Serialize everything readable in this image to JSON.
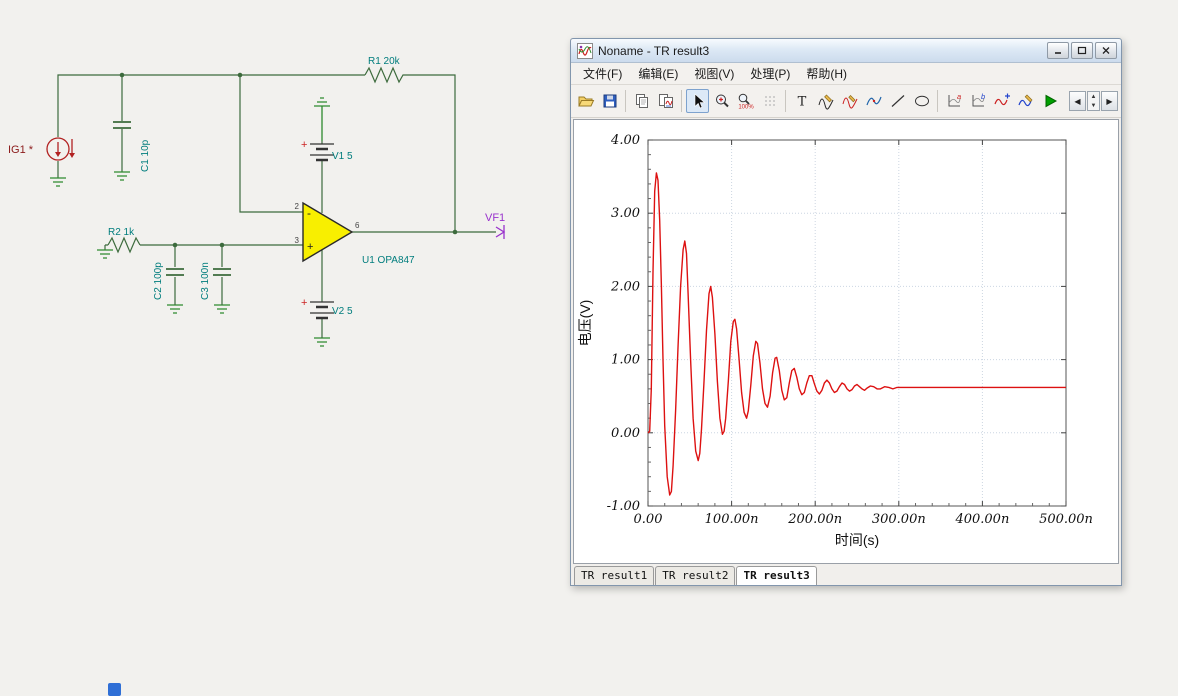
{
  "desktop": {
    "background": "#f2f1ee"
  },
  "schematic": {
    "labels": {
      "ig1": "IG1 *",
      "c1": "C1 10p",
      "r1": "R1 20k",
      "r2": "R2 1k",
      "c2": "C2 100p",
      "c3": "C3 100n",
      "v1": "V1 5",
      "v2": "V2 5",
      "u1": "U1 OPA847",
      "vf1": "VF1",
      "pin_inverting": "2",
      "pin_noninverting": "3",
      "pin_output": "6",
      "minus_sign": "-",
      "plus_sign": "+",
      "v1_plus": "+",
      "v2_plus": "+"
    },
    "colors": {
      "wire": "#3d6b3d",
      "label": "#007d7d",
      "source": "#b22222",
      "opamp_fill": "#f8ef00",
      "output_label": "#9932cc"
    }
  },
  "window": {
    "title": "Noname - TR result3",
    "menu": [
      "文件(F)",
      "编辑(E)",
      "视图(V)",
      "处理(P)",
      "帮助(H)"
    ],
    "toolbar": {
      "text_tool_glyph": "T",
      "zoom_level": "100%",
      "axis_a": "a",
      "axis_b": "b"
    },
    "tabs": [
      {
        "label": "TR result1",
        "active": false
      },
      {
        "label": "TR result2",
        "active": false
      },
      {
        "label": "TR result3",
        "active": true
      }
    ]
  },
  "chart_data": {
    "type": "line",
    "title": "",
    "xlabel": "时间(s)",
    "ylabel": "电压(V)",
    "x_unit": "ns",
    "xlim": [
      0,
      500
    ],
    "ylim": [
      -1,
      4
    ],
    "x_ticks": [
      0,
      100,
      200,
      300,
      400,
      500
    ],
    "x_tick_labels": [
      "0.00",
      "100.00n",
      "200.00n",
      "300.00n",
      "400.00n",
      "500.00n"
    ],
    "y_ticks": [
      -1,
      0,
      1,
      2,
      3,
      4
    ],
    "y_tick_labels": [
      "-1.00",
      "0.00",
      "1.00",
      "2.00",
      "3.00",
      "4.00"
    ],
    "grid": true,
    "legend": "none",
    "series": [
      {
        "name": "VF1",
        "color": "#dd1111",
        "points": [
          [
            0,
            0
          ],
          [
            2,
            0.02
          ],
          [
            4,
            0.6
          ],
          [
            6,
            2.2
          ],
          [
            8,
            3.3
          ],
          [
            10,
            3.55
          ],
          [
            12,
            3.45
          ],
          [
            14,
            2.9
          ],
          [
            16,
            2.0
          ],
          [
            18,
            1.0
          ],
          [
            20,
            0.1
          ],
          [
            23,
            -0.6
          ],
          [
            26,
            -0.85
          ],
          [
            28,
            -0.8
          ],
          [
            30,
            -0.45
          ],
          [
            33,
            0.3
          ],
          [
            36,
            1.2
          ],
          [
            39,
            2.0
          ],
          [
            42,
            2.5
          ],
          [
            44,
            2.62
          ],
          [
            46,
            2.45
          ],
          [
            48,
            1.9
          ],
          [
            51,
            1.0
          ],
          [
            54,
            0.2
          ],
          [
            57,
            -0.25
          ],
          [
            60,
            -0.38
          ],
          [
            62,
            -0.28
          ],
          [
            64,
            0.05
          ],
          [
            67,
            0.7
          ],
          [
            70,
            1.4
          ],
          [
            73,
            1.9
          ],
          [
            75,
            2.0
          ],
          [
            77,
            1.85
          ],
          [
            80,
            1.35
          ],
          [
            83,
            0.7
          ],
          [
            86,
            0.2
          ],
          [
            89,
            -0.02
          ],
          [
            91,
            0.02
          ],
          [
            93,
            0.2
          ],
          [
            96,
            0.7
          ],
          [
            99,
            1.25
          ],
          [
            102,
            1.52
          ],
          [
            104,
            1.55
          ],
          [
            106,
            1.42
          ],
          [
            109,
            1.0
          ],
          [
            112,
            0.55
          ],
          [
            115,
            0.28
          ],
          [
            118,
            0.2
          ],
          [
            120,
            0.3
          ],
          [
            123,
            0.65
          ],
          [
            126,
            1.05
          ],
          [
            129,
            1.25
          ],
          [
            131,
            1.22
          ],
          [
            134,
            0.95
          ],
          [
            137,
            0.6
          ],
          [
            140,
            0.4
          ],
          [
            143,
            0.35
          ],
          [
            146,
            0.5
          ],
          [
            149,
            0.82
          ],
          [
            152,
            1.02
          ],
          [
            154,
            1.03
          ],
          [
            157,
            0.85
          ],
          [
            160,
            0.58
          ],
          [
            163,
            0.45
          ],
          [
            166,
            0.48
          ],
          [
            169,
            0.68
          ],
          [
            172,
            0.85
          ],
          [
            175,
            0.88
          ],
          [
            178,
            0.76
          ],
          [
            181,
            0.6
          ],
          [
            184,
            0.52
          ],
          [
            187,
            0.55
          ],
          [
            190,
            0.68
          ],
          [
            193,
            0.78
          ],
          [
            196,
            0.78
          ],
          [
            199,
            0.67
          ],
          [
            202,
            0.57
          ],
          [
            205,
            0.53
          ],
          [
            208,
            0.58
          ],
          [
            211,
            0.68
          ],
          [
            214,
            0.72
          ],
          [
            217,
            0.68
          ],
          [
            220,
            0.6
          ],
          [
            223,
            0.55
          ],
          [
            226,
            0.57
          ],
          [
            229,
            0.63
          ],
          [
            232,
            0.68
          ],
          [
            235,
            0.66
          ],
          [
            238,
            0.6
          ],
          [
            241,
            0.57
          ],
          [
            244,
            0.59
          ],
          [
            247,
            0.64
          ],
          [
            250,
            0.66
          ],
          [
            253,
            0.63
          ],
          [
            256,
            0.6
          ],
          [
            259,
            0.58
          ],
          [
            262,
            0.61
          ],
          [
            266,
            0.64
          ],
          [
            270,
            0.63
          ],
          [
            274,
            0.6
          ],
          [
            278,
            0.6
          ],
          [
            283,
            0.63
          ],
          [
            288,
            0.62
          ],
          [
            293,
            0.6
          ],
          [
            298,
            0.62
          ],
          [
            305,
            0.62
          ],
          [
            315,
            0.62
          ],
          [
            330,
            0.62
          ],
          [
            350,
            0.62
          ],
          [
            375,
            0.62
          ],
          [
            400,
            0.62
          ],
          [
            430,
            0.62
          ],
          [
            465,
            0.62
          ],
          [
            500,
            0.62
          ]
        ]
      }
    ]
  }
}
